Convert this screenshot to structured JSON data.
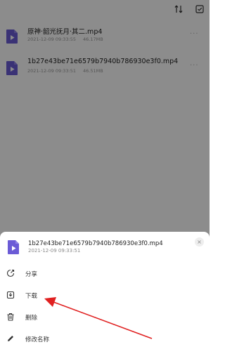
{
  "files": [
    {
      "name": "原神·韶光抚月·其二.mp4",
      "date": "2021-12-09 09:33:55",
      "size": "46.17MB",
      "more": "···"
    },
    {
      "name": "1b27e43be71e6579b7940b786930e3f0.mp4",
      "date": "2021-12-09 09:33:51",
      "size": "46.51MB",
      "more": "···"
    }
  ],
  "sheet": {
    "file_name": "1b27e43be71e6579b7940b786930e3f0.mp4",
    "file_date": "2021-12-09 09:33:51",
    "close": "×",
    "actions": [
      {
        "label": "分享",
        "icon": "share-icon"
      },
      {
        "label": "下载",
        "icon": "download-icon"
      },
      {
        "label": "删除",
        "icon": "trash-icon"
      },
      {
        "label": "修改名称",
        "icon": "pencil-icon"
      }
    ]
  },
  "colors": {
    "file_icon": "#6b5bd6",
    "annotation_arrow": "#e02020"
  }
}
